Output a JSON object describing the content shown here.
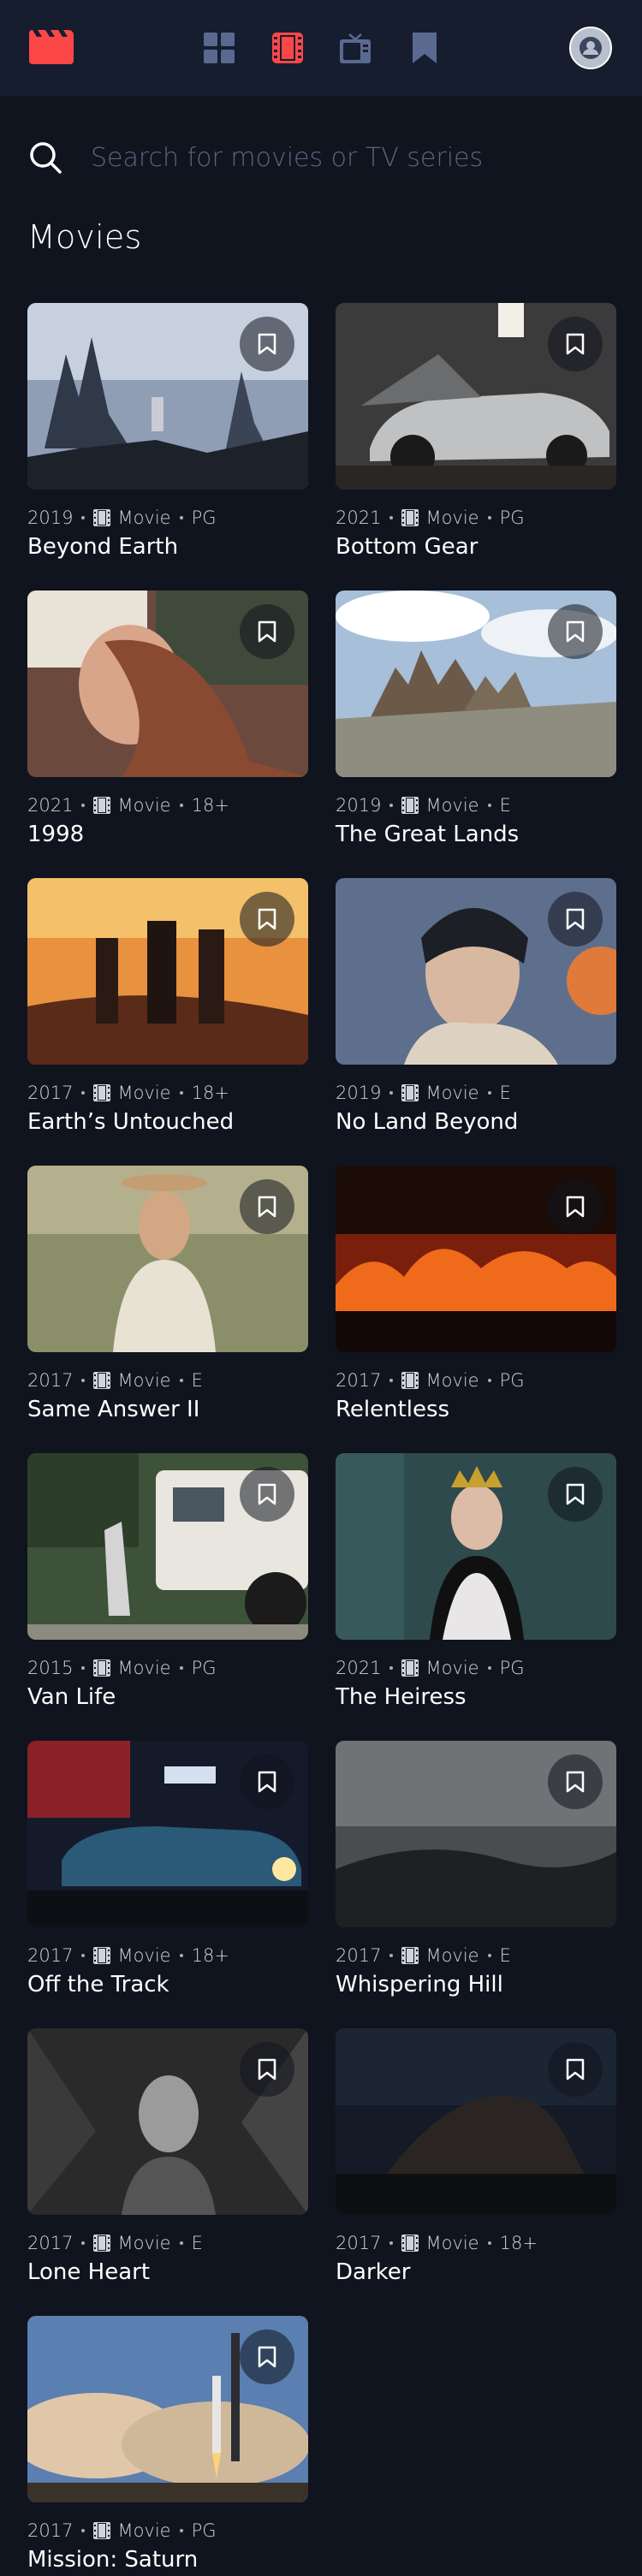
{
  "nav": {
    "logo_icon": "clapperboard-logo-icon",
    "items": [
      {
        "icon": "grid-home-icon",
        "active": false
      },
      {
        "icon": "film-movies-icon",
        "active": true
      },
      {
        "icon": "tv-series-icon",
        "active": false
      },
      {
        "icon": "bookmark-nav-icon",
        "active": false
      }
    ],
    "avatar_icon": "user-avatar"
  },
  "colors": {
    "background": "#10141e",
    "nav_background": "#161d2f",
    "accent": "#fc4747",
    "nav_icon_inactive": "#5a698f",
    "muted_text": "#5a6480"
  },
  "search": {
    "placeholder": "Search for movies or TV series",
    "value": ""
  },
  "section": {
    "title": "Movies"
  },
  "movies": [
    {
      "year": "2019",
      "category": "Movie",
      "rating": "PG",
      "title": "Beyond Earth",
      "theme": "sea-stacks"
    },
    {
      "year": "2021",
      "category": "Movie",
      "rating": "PG",
      "title": "Bottom Gear",
      "theme": "garage-car"
    },
    {
      "year": "2021",
      "category": "Movie",
      "rating": "18+",
      "title": "1998",
      "theme": "portrait-warm"
    },
    {
      "year": "2019",
      "category": "Movie",
      "rating": "E",
      "title": "The Great Lands",
      "theme": "mountains"
    },
    {
      "year": "2017",
      "category": "Movie",
      "rating": "18+",
      "title": "Earth’s Untouched",
      "theme": "sunset-people"
    },
    {
      "year": "2019",
      "category": "Movie",
      "rating": "E",
      "title": "No Land Beyond",
      "theme": "portrait-cool"
    },
    {
      "year": "2017",
      "category": "Movie",
      "rating": "E",
      "title": "Same Answer II",
      "theme": "field-woman"
    },
    {
      "year": "2017",
      "category": "Movie",
      "rating": "PG",
      "title": "Relentless",
      "theme": "fire"
    },
    {
      "year": "2015",
      "category": "Movie",
      "rating": "PG",
      "title": "Van Life",
      "theme": "van"
    },
    {
      "year": "2021",
      "category": "Movie",
      "rating": "PG",
      "title": "The Heiress",
      "theme": "queen"
    },
    {
      "year": "2017",
      "category": "Movie",
      "rating": "18+",
      "title": "Off the Track",
      "theme": "night-car"
    },
    {
      "year": "2017",
      "category": "Movie",
      "rating": "E",
      "title": "Whispering Hill",
      "theme": "fog-hill"
    },
    {
      "year": "2017",
      "category": "Movie",
      "rating": "E",
      "title": "Lone Heart",
      "theme": "bw-face"
    },
    {
      "year": "2017",
      "category": "Movie",
      "rating": "18+",
      "title": "Darker",
      "theme": "dark-creature"
    },
    {
      "year": "2017",
      "category": "Movie",
      "rating": "PG",
      "title": "Mission: Saturn",
      "theme": "rocket"
    }
  ]
}
